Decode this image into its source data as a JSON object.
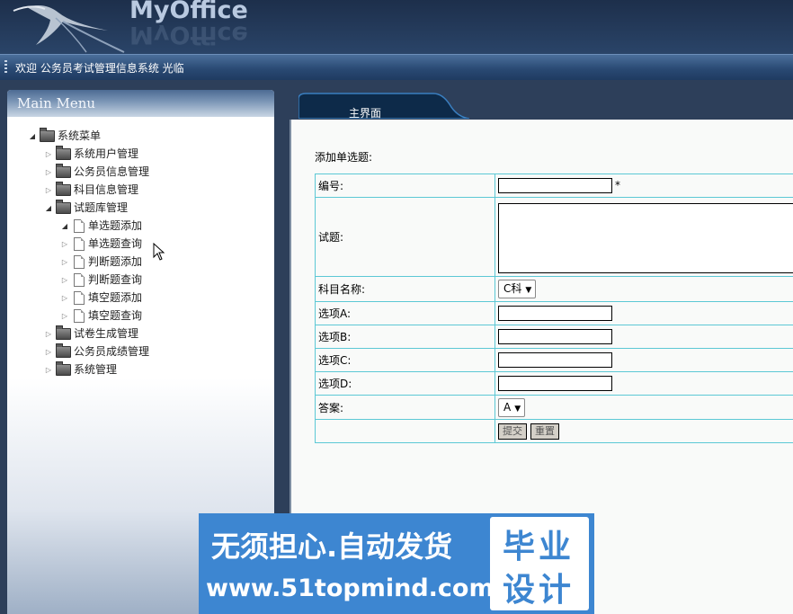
{
  "header": {
    "title": "MyOffice"
  },
  "welcome_bar": {
    "text": "欢迎 公务员考试管理信息系统 光临"
  },
  "sidebar": {
    "title": "Main Menu",
    "tree": [
      {
        "label": "系统菜单",
        "type": "folder",
        "level": 0,
        "expanded": true
      },
      {
        "label": "系统用户管理",
        "type": "folder",
        "level": 1,
        "expanded": false
      },
      {
        "label": "公务员信息管理",
        "type": "folder",
        "level": 1,
        "expanded": false
      },
      {
        "label": "科目信息管理",
        "type": "folder",
        "level": 1,
        "expanded": false
      },
      {
        "label": "试题库管理",
        "type": "folder",
        "level": 1,
        "expanded": true
      },
      {
        "label": "单选题添加",
        "type": "file",
        "level": 2,
        "expanded": true
      },
      {
        "label": "单选题查询",
        "type": "file",
        "level": 2,
        "expanded": false
      },
      {
        "label": "判断题添加",
        "type": "file",
        "level": 2,
        "expanded": false
      },
      {
        "label": "判断题查询",
        "type": "file",
        "level": 2,
        "expanded": false
      },
      {
        "label": "填空题添加",
        "type": "file",
        "level": 2,
        "expanded": false
      },
      {
        "label": "填空题查询",
        "type": "file",
        "level": 2,
        "expanded": false
      },
      {
        "label": "试卷生成管理",
        "type": "folder",
        "level": 1,
        "expanded": false
      },
      {
        "label": "公务员成绩管理",
        "type": "folder",
        "level": 1,
        "expanded": false
      },
      {
        "label": "系统管理",
        "type": "folder",
        "level": 1,
        "expanded": false
      }
    ]
  },
  "tabs": [
    {
      "label": "主界面",
      "active": true
    }
  ],
  "form": {
    "title": "添加单选题:",
    "fields": {
      "id_label": "编号:",
      "id_value": "",
      "required_mark": "*",
      "question_label": "试题:",
      "question_value": "",
      "subject_label": "科目名称:",
      "subject_selected": "C科",
      "option_a_label": "选项A:",
      "option_b_label": "选项B:",
      "option_c_label": "选项C:",
      "option_d_label": "选项D:",
      "answer_label": "答案:",
      "answer_selected": "A"
    },
    "buttons": {
      "submit": "提交",
      "reset": "重置"
    }
  },
  "watermark": {
    "line1": "无须担心.自动发货",
    "line2": "www.51topmind.com",
    "side_line1": "毕业",
    "side_line2": "设计"
  },
  "colors": {
    "header_bg": "#1d2f4b",
    "table_border": "#5cc8d5",
    "banner_bg": "#3d86d1"
  }
}
